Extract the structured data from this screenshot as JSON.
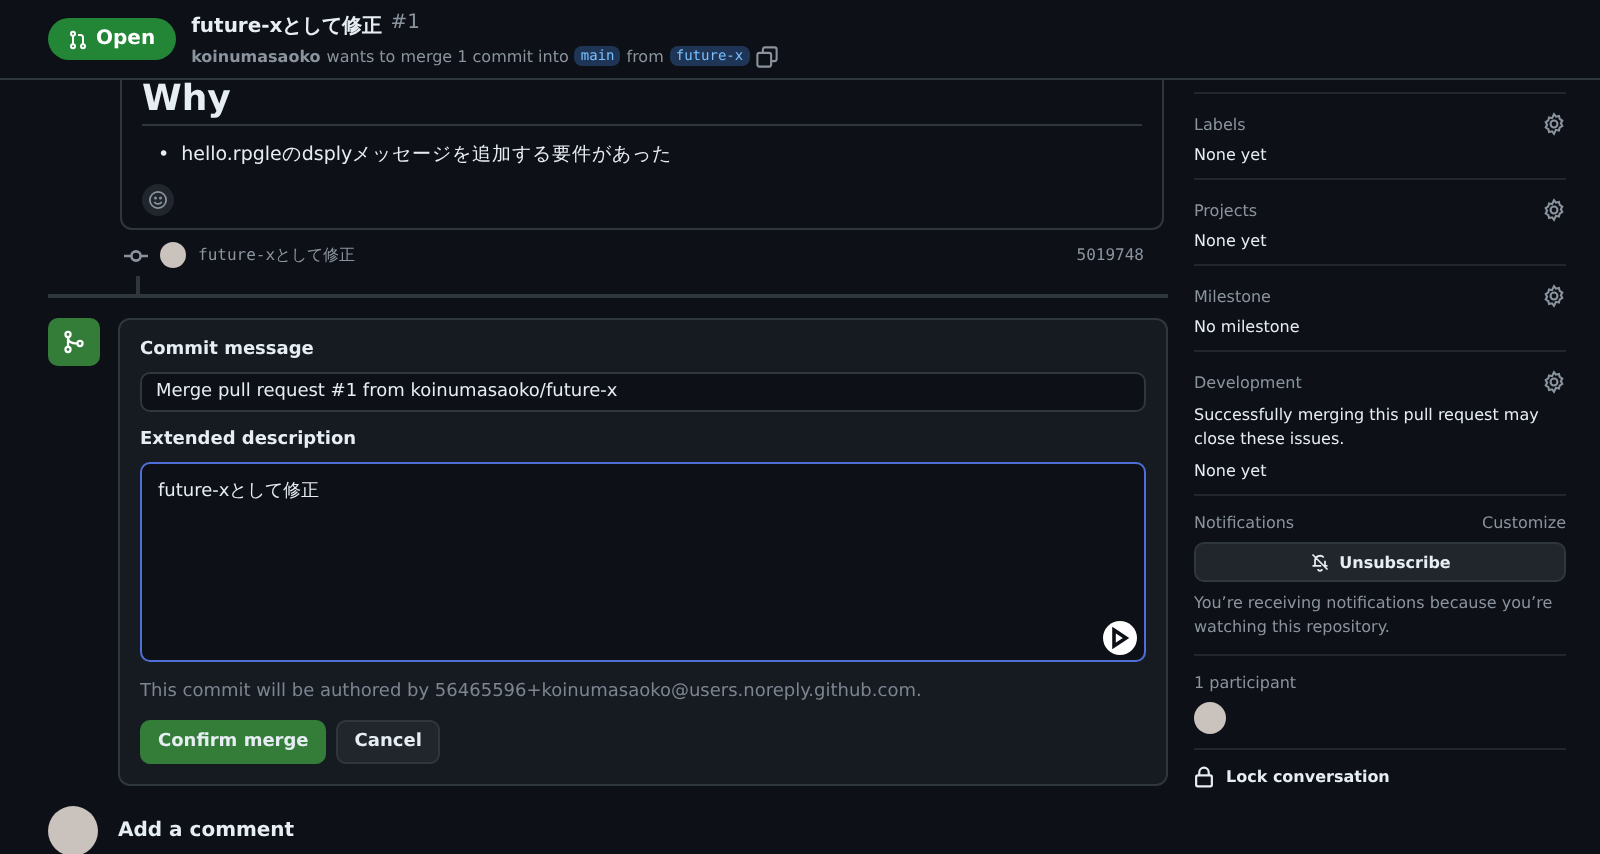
{
  "header": {
    "state": "Open",
    "title": "future-xとして修正",
    "number": "#1",
    "author": "koinumasaoko",
    "merge_text": "wants to merge 1 commit into",
    "base_branch": "main",
    "from_text": "from",
    "head_branch": "future-x"
  },
  "comment": {
    "heading": "Why",
    "marker": "•",
    "bullets": [
      "hello.rpgleのdsplyメッセージを追加する要件があった"
    ]
  },
  "commit": {
    "message": "future-xとして修正",
    "sha": "5019748"
  },
  "merge_form": {
    "commit_message_label": "Commit message",
    "commit_message_value": "Merge pull request #1 from koinumasaoko/future-x",
    "description_label": "Extended description",
    "description_value": "future-xとして修正",
    "author_note": "This commit will be authored by 56465596+koinumasaoko@users.noreply.github.com.",
    "buttons": [
      {
        "label": "Confirm merge",
        "kind": "primary"
      },
      {
        "label": "Cancel",
        "kind": "secondary"
      }
    ]
  },
  "add_comment": {
    "title": "Add a comment"
  },
  "sidebar": {
    "sections": [
      {
        "title": "Labels",
        "value": "None yet"
      },
      {
        "title": "Projects",
        "value": "None yet"
      },
      {
        "title": "Milestone",
        "value": "No milestone"
      },
      {
        "title": "Development",
        "note": "Successfully merging this pull request may close these issues.",
        "value": "None yet"
      }
    ],
    "notifications": {
      "title": "Notifications",
      "action": "Customize",
      "button": "Unsubscribe",
      "note": "You’re receiving notifications because you’re watching this repository."
    },
    "participants": {
      "title": "1 participant"
    },
    "lock": {
      "label": "Lock conversation"
    }
  }
}
